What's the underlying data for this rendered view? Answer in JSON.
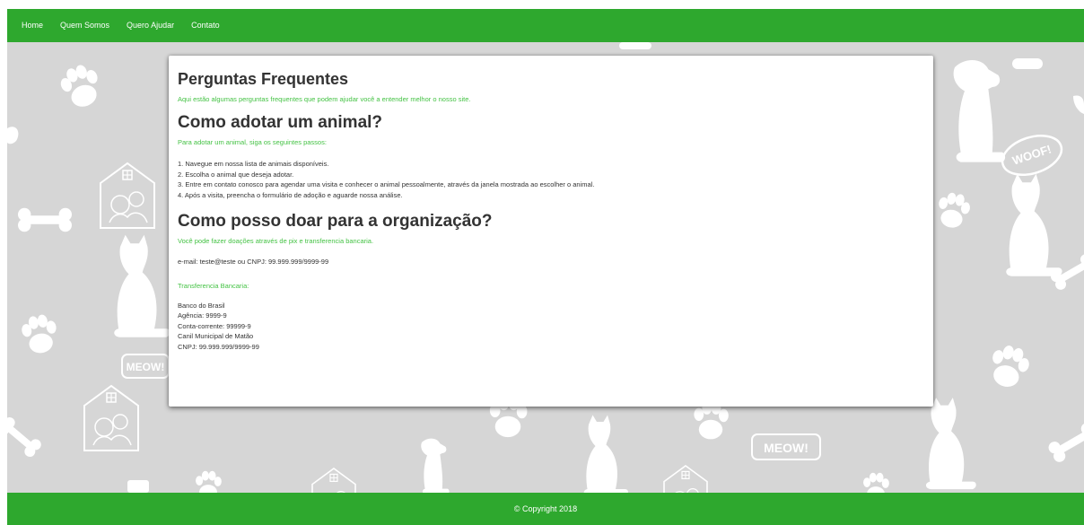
{
  "nav": {
    "items": [
      "Home",
      "Quem Somos",
      "Quero Ajudar",
      "Contato"
    ]
  },
  "faq": {
    "title": "Perguntas Frequentes",
    "intro": "Aqui estão algumas perguntas frequentes que podem ajudar você a entender melhor o nosso site.",
    "adopt": {
      "title": "Como adotar um animal?",
      "intro": "Para adotar um animal, siga os seguintes passos:",
      "steps": [
        "1. Navegue em nossa lista de animais disponíveis.",
        "2. Escolha o animal que deseja adotar.",
        "3. Entre em contato conosco para agendar uma visita e conhecer o animal pessoalmente, através da janela mostrada ao escolher o animal.",
        "4. Após a visita, preencha o formulário de adoção e aguarde nossa análise."
      ]
    },
    "donate": {
      "title": "Como posso doar para a organização?",
      "intro": "Você pode fazer doações através de pix e transferencia bancaria.",
      "pix": "e-mail: teste@teste ou CNPJ: 99.999.999/9999-99",
      "bank_title": "Transferencia Bancaria:",
      "bank_lines": [
        "Banco do Brasil",
        "Agência: 9999-9",
        "Conta-corrente: 99999-9",
        "Canil Municipal de Matão",
        "CNPJ: 99.999.999/9999-99"
      ]
    }
  },
  "background": {
    "badges": [
      "WOOF!",
      "MEOW!",
      "MEOW!"
    ]
  },
  "footer": {
    "copyright": "© Copyright 2018"
  },
  "colors": {
    "brand_green": "#2ea82e",
    "accent_text_green": "#44c244",
    "background_gray": "#d6d6d6"
  }
}
